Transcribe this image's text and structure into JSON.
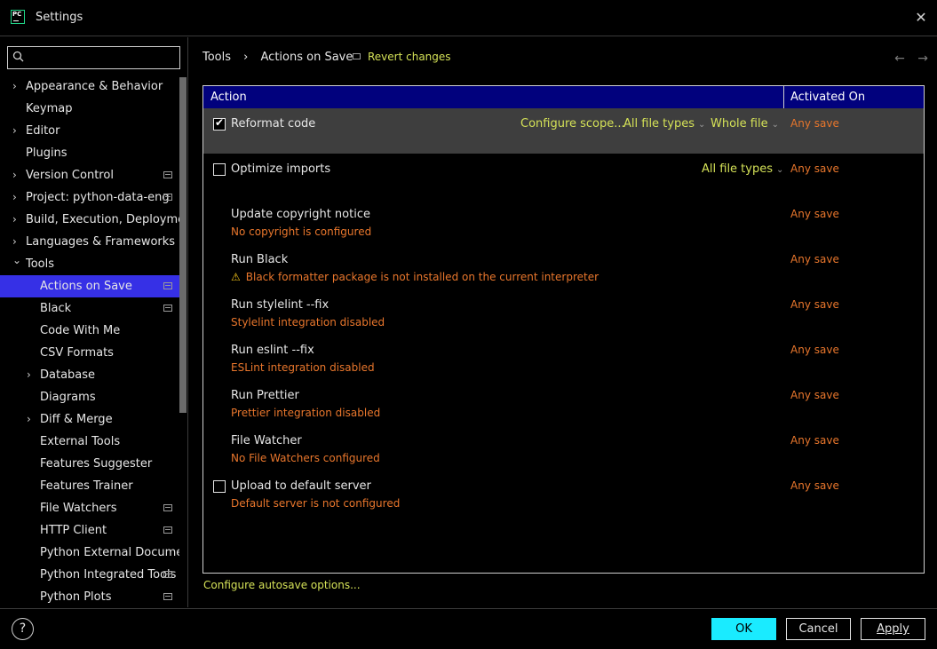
{
  "window": {
    "title": "Settings",
    "app_icon_text": "PC"
  },
  "search": {
    "placeholder": ""
  },
  "sidebar": {
    "items": [
      {
        "label": "Appearance & Behavior",
        "chevron": true,
        "indent": 0,
        "icon": false
      },
      {
        "label": "Keymap",
        "chevron": false,
        "indent": 0,
        "icon": false
      },
      {
        "label": "Editor",
        "chevron": true,
        "indent": 0,
        "icon": false
      },
      {
        "label": "Plugins",
        "chevron": false,
        "indent": 0,
        "icon": false
      },
      {
        "label": "Version Control",
        "chevron": true,
        "indent": 0,
        "icon": true
      },
      {
        "label": "Project: python-data-eng",
        "chevron": true,
        "indent": 0,
        "icon": true
      },
      {
        "label": "Build, Execution, Deploymer",
        "chevron": true,
        "indent": 0,
        "icon": false
      },
      {
        "label": "Languages & Frameworks",
        "chevron": true,
        "indent": 0,
        "icon": false
      },
      {
        "label": "Tools",
        "chevron": "open",
        "indent": 0,
        "icon": false
      },
      {
        "label": "Actions on Save",
        "chevron": false,
        "indent": 1,
        "icon": true,
        "selected": true
      },
      {
        "label": "Black",
        "chevron": false,
        "indent": 1,
        "icon": true
      },
      {
        "label": "Code With Me",
        "chevron": false,
        "indent": 1,
        "icon": false
      },
      {
        "label": "CSV Formats",
        "chevron": false,
        "indent": 1,
        "icon": false
      },
      {
        "label": "Database",
        "chevron": true,
        "indent": 1,
        "icon": false
      },
      {
        "label": "Diagrams",
        "chevron": false,
        "indent": 1,
        "icon": false
      },
      {
        "label": "Diff & Merge",
        "chevron": true,
        "indent": 1,
        "icon": false
      },
      {
        "label": "External Tools",
        "chevron": false,
        "indent": 1,
        "icon": false
      },
      {
        "label": "Features Suggester",
        "chevron": false,
        "indent": 1,
        "icon": false
      },
      {
        "label": "Features Trainer",
        "chevron": false,
        "indent": 1,
        "icon": false
      },
      {
        "label": "File Watchers",
        "chevron": false,
        "indent": 1,
        "icon": true
      },
      {
        "label": "HTTP Client",
        "chevron": false,
        "indent": 1,
        "icon": true
      },
      {
        "label": "Python External Document",
        "chevron": false,
        "indent": 1,
        "icon": false
      },
      {
        "label": "Python Integrated Tools",
        "chevron": false,
        "indent": 1,
        "icon": true
      },
      {
        "label": "Python Plots",
        "chevron": false,
        "indent": 1,
        "icon": true
      }
    ]
  },
  "breadcrumb": {
    "parent": "Tools",
    "separator": "›",
    "current": "Actions on Save"
  },
  "revert_label": "Revert changes",
  "nav": {
    "back": "←",
    "forward": "→"
  },
  "table": {
    "col_action": "Action",
    "col_activated": "Activated On",
    "rows": [
      {
        "title": "Reformat code",
        "checkbox": "checked",
        "options": [
          "Configure scope...",
          "All file types",
          "Whole file"
        ],
        "activated": "Any save",
        "highlight": true
      },
      {
        "title": "Optimize imports",
        "checkbox": "unchecked",
        "options": [
          "All file types"
        ],
        "activated": "Any save"
      },
      {
        "title": "Update copyright notice",
        "subtitle": "No copyright is configured",
        "activated": "Any save"
      },
      {
        "title": "Run Black",
        "subtitle": "Black formatter package is not installed on the current interpreter",
        "warning": true,
        "activated": "Any save"
      },
      {
        "title": "Run stylelint --fix",
        "subtitle": "Stylelint integration disabled",
        "activated": "Any save"
      },
      {
        "title": "Run eslint --fix",
        "subtitle": "ESLint integration disabled",
        "activated": "Any save"
      },
      {
        "title": "Run Prettier",
        "subtitle": "Prettier integration disabled",
        "activated": "Any save"
      },
      {
        "title": "File Watcher",
        "subtitle": "No File Watchers configured",
        "activated": "Any save"
      },
      {
        "title": "Upload to default server",
        "checkbox": "unchecked",
        "subtitle": "Default server is not configured",
        "activated": "Any save"
      }
    ]
  },
  "autosave_link": "Configure autosave options...",
  "footer": {
    "help": "?",
    "ok": "OK",
    "cancel": "Cancel",
    "apply": "Apply"
  },
  "colors": {
    "accent_link": "#d4e157",
    "warning_text": "#e8762c",
    "selection": "#3630e6",
    "table_header": "#01017d",
    "ok_button": "#1aebff"
  }
}
